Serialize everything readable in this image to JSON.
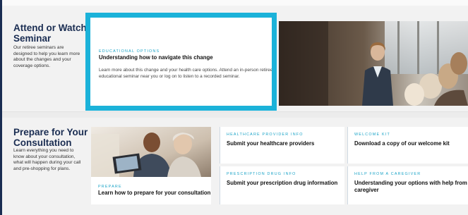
{
  "sections": {
    "seminar": {
      "title_line1": "Attend or Watch a",
      "title_line2": "Seminar",
      "desc_line1": "Our retiree seminars are",
      "desc_line2": "designed to help you learn more",
      "desc_line3": "about the changes and your",
      "desc_line4": "coverage options."
    },
    "consultation": {
      "title_line1": "Prepare for Your",
      "title_line2": "Consultation",
      "desc_line1": "Learn everything you need to",
      "desc_line2": "know about your consultation,",
      "desc_line3": "what will happen during your call",
      "desc_line4": "and pre-shopping for plans."
    }
  },
  "cards": {
    "educational": {
      "eyebrow": "EDUCATIONAL OPTIONS",
      "title": "Understanding how to navigate this change",
      "body_line1": "Learn more about this change and your health care options. Attend an in-person retiree",
      "body_line2": "educational seminar near you or log on to listen to a recorded seminar."
    },
    "prepare": {
      "eyebrow": "PREPARE",
      "title": "Learn how to prepare for your consultation"
    },
    "provider": {
      "eyebrow": "HEALTHCARE PROVIDER INFO",
      "title": "Submit your healthcare providers"
    },
    "welcome": {
      "eyebrow": "WELCOME KIT",
      "title": "Download a copy of our welcome kit"
    },
    "prescription": {
      "eyebrow": "PRESCRIPTION DRUG INFO",
      "title": "Submit your prescription drug information"
    },
    "caregiver": {
      "eyebrow": "HELP FROM A CAREGIVER",
      "title_line1": "Understanding your options with help from a",
      "title_line2": "caregiver"
    }
  },
  "colors": {
    "heading": "#1a2d52",
    "eyebrow": "#1aa3c7",
    "highlight": "#1bb2d9"
  }
}
